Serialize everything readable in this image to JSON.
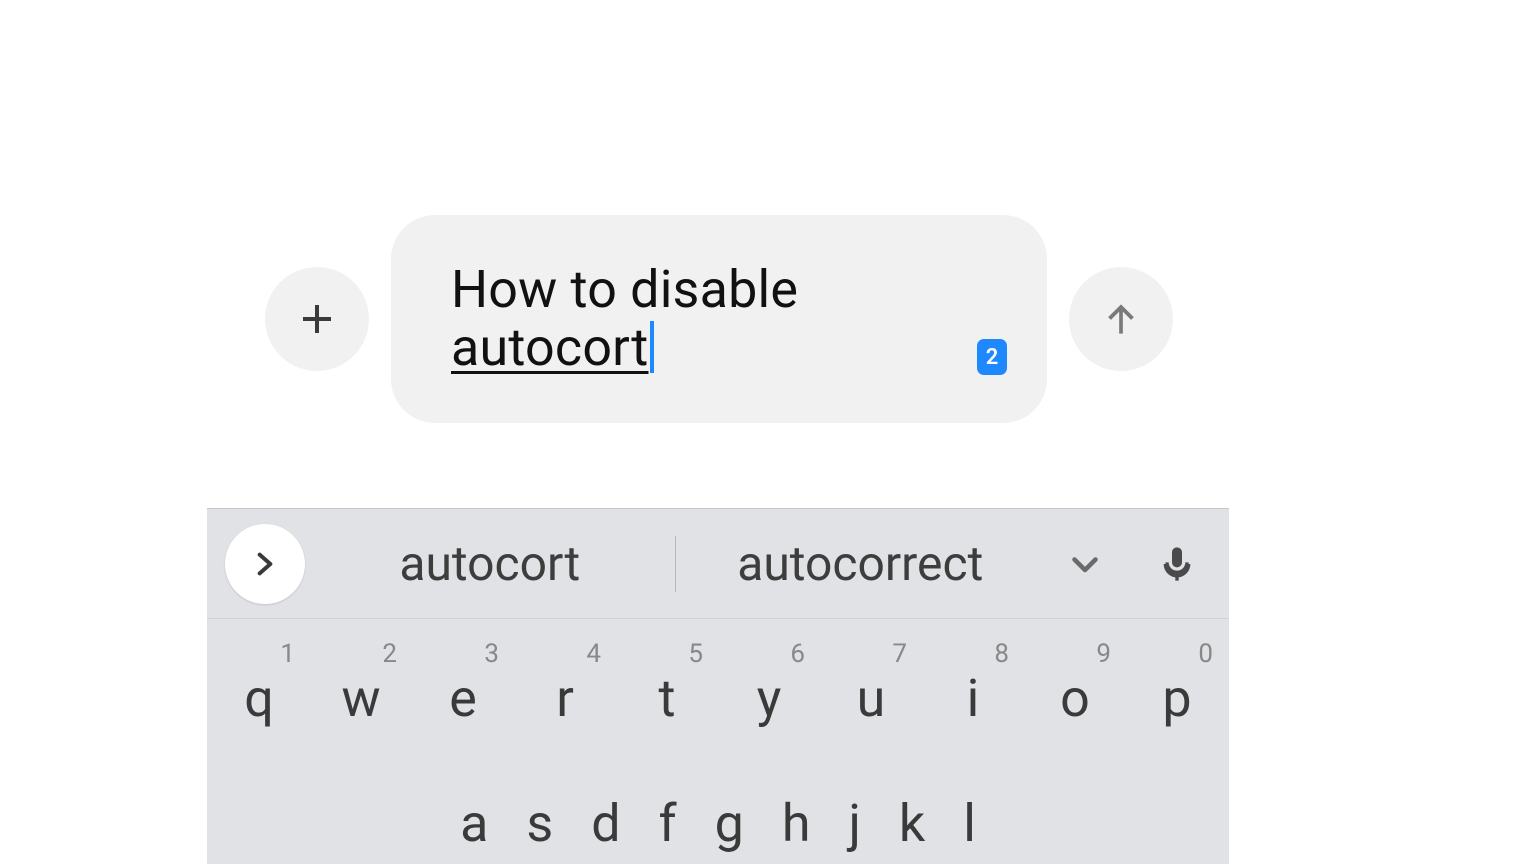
{
  "compose": {
    "text_plain_prefix": "How to disable ",
    "underlined_word": "autocort",
    "badge_count": "2"
  },
  "icons": {
    "plus": "plus-icon",
    "up": "arrow-up-icon",
    "chevron_right": "chevron-right-icon",
    "chevron_down": "chevron-down-icon",
    "mic": "microphone-icon"
  },
  "keyboard": {
    "suggestions": [
      "autocort",
      "autocorrect"
    ],
    "row1": [
      {
        "k": "q",
        "n": "1"
      },
      {
        "k": "w",
        "n": "2"
      },
      {
        "k": "e",
        "n": "3"
      },
      {
        "k": "r",
        "n": "4"
      },
      {
        "k": "t",
        "n": "5"
      },
      {
        "k": "y",
        "n": "6"
      },
      {
        "k": "u",
        "n": "7"
      },
      {
        "k": "i",
        "n": "8"
      },
      {
        "k": "o",
        "n": "9"
      },
      {
        "k": "p",
        "n": "0"
      }
    ],
    "row2": [
      "a",
      "s",
      "d",
      "f",
      "g",
      "h",
      "j",
      "k",
      "l"
    ]
  }
}
